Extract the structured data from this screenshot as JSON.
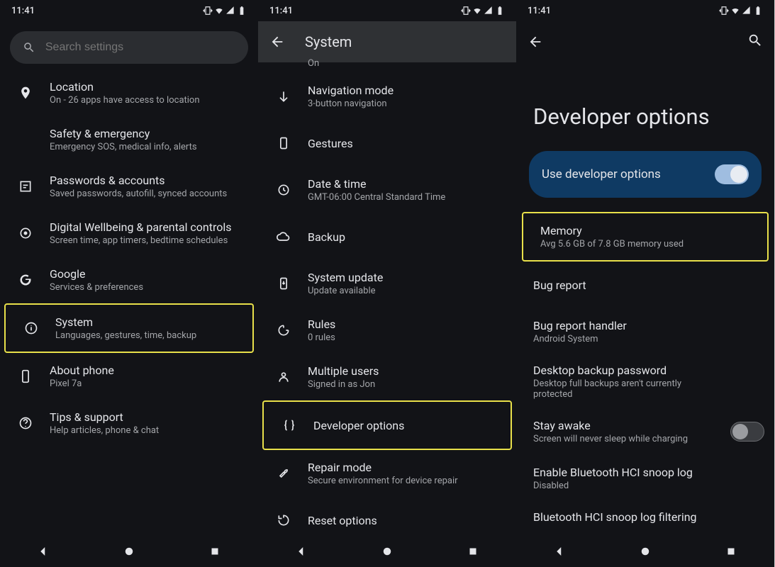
{
  "status": {
    "time": "11:41"
  },
  "panel1": {
    "search_placeholder": "Search settings",
    "items": [
      {
        "name": "location",
        "title": "Location",
        "sub": "On - 26 apps have access to location"
      },
      {
        "name": "safety",
        "title": "Safety & emergency",
        "sub": "Emergency SOS, medical info, alerts"
      },
      {
        "name": "passwords",
        "title": "Passwords & accounts",
        "sub": "Saved passwords, autofill, synced accounts"
      },
      {
        "name": "wellbeing",
        "title": "Digital Wellbeing & parental controls",
        "sub": "Screen time, app timers, bedtime schedules"
      },
      {
        "name": "google",
        "title": "Google",
        "sub": "Services & preferences"
      },
      {
        "name": "system",
        "title": "System",
        "sub": "Languages, gestures, time, backup"
      },
      {
        "name": "about",
        "title": "About phone",
        "sub": "Pixel 7a"
      },
      {
        "name": "tips",
        "title": "Tips & support",
        "sub": "Help articles, phone & chat"
      }
    ]
  },
  "panel2": {
    "title": "System",
    "on_text": "On",
    "items": [
      {
        "name": "navmode",
        "title": "Navigation mode",
        "sub": "3-button navigation"
      },
      {
        "name": "gestures",
        "title": "Gestures",
        "sub": ""
      },
      {
        "name": "datetime",
        "title": "Date & time",
        "sub": "GMT-06:00 Central Standard Time"
      },
      {
        "name": "backup",
        "title": "Backup",
        "sub": ""
      },
      {
        "name": "sysupdate",
        "title": "System update",
        "sub": "Update available"
      },
      {
        "name": "rules",
        "title": "Rules",
        "sub": "0 rules"
      },
      {
        "name": "multiusers",
        "title": "Multiple users",
        "sub": "Signed in as Jon"
      },
      {
        "name": "devops",
        "title": "Developer options",
        "sub": ""
      },
      {
        "name": "repair",
        "title": "Repair mode",
        "sub": "Secure environment for device repair"
      },
      {
        "name": "reset",
        "title": "Reset options",
        "sub": ""
      }
    ]
  },
  "panel3": {
    "title": "Developer options",
    "toggle_label": "Use developer options",
    "toggle_on": true,
    "items": [
      {
        "name": "memory",
        "title": "Memory",
        "sub": "Avg 5.6 GB of 7.8 GB memory used"
      },
      {
        "name": "bugreport",
        "title": "Bug report",
        "sub": ""
      },
      {
        "name": "bughandler",
        "title": "Bug report handler",
        "sub": "Android System"
      },
      {
        "name": "desktopbackup",
        "title": "Desktop backup password",
        "sub": "Desktop full backups aren't currently protected"
      },
      {
        "name": "stayawake",
        "title": "Stay awake",
        "sub": "Screen will never sleep while charging",
        "switch": "off"
      },
      {
        "name": "btlog",
        "title": "Enable Bluetooth HCI snoop log",
        "sub": "Disabled"
      },
      {
        "name": "btfilter",
        "title": "Bluetooth HCI snoop log filtering",
        "sub": ""
      }
    ]
  }
}
